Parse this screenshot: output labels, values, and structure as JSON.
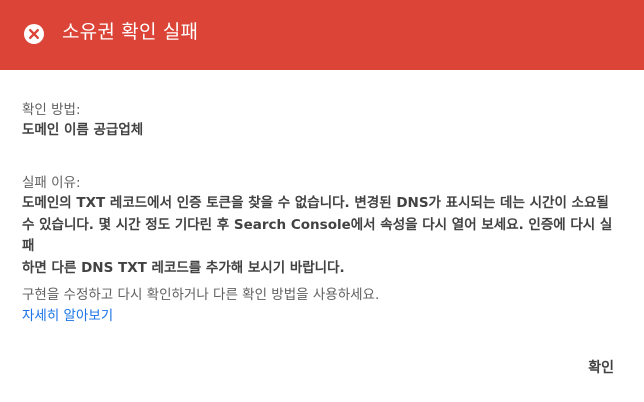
{
  "header": {
    "title": "소유권 확인 실패",
    "icon": "close-circle-icon",
    "background_color": "#db4437"
  },
  "method": {
    "label": "확인 방법:",
    "value": "도메인 이름 공급업체"
  },
  "reason": {
    "label": "실패 이유:",
    "lines": [
      "도메인의 TXT 레코드에서 인증 토큰을 찾을 수 없습니다. 변경된 DNS가 표시되는 데는 시간이 소요될",
      "수 있습니다. 몇 시간 정도 기다린 후 Search Console에서 속성을 다시 열어 보세요. 인증에 다시 실패",
      "하면 다른 DNS TXT 레코드를 추가해 보시기 바랍니다."
    ]
  },
  "help": {
    "text": "구현을 수정하고 다시 확인하거나 다른 확인 방법을 사용하세요.",
    "link_label": "자세히 알아보기",
    "link_color": "#1a73e8"
  },
  "actions": {
    "confirm_label": "확인"
  }
}
